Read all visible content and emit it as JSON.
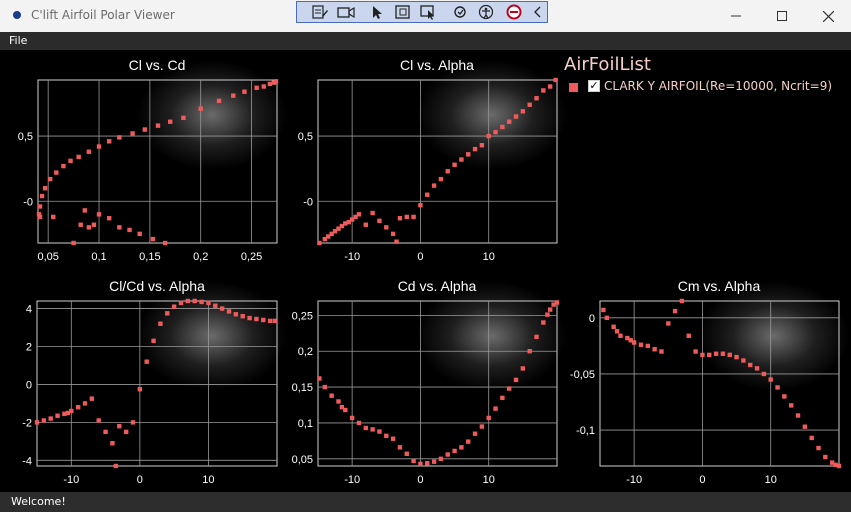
{
  "window": {
    "title": "C'lift Airfoil Polar Viewer"
  },
  "menu": {
    "file": "File"
  },
  "status": {
    "text": "Welcome!"
  },
  "legend": {
    "title": "AirFoilList",
    "item": "CLARK Y AIRFOIL(Re=10000, Ncrit=9)",
    "checked": true
  },
  "colors": {
    "series": "#ef5b5b",
    "grid": "#9a9a9a",
    "background": "#000000"
  },
  "toolbar": {
    "icons": [
      "edit-grid-icon",
      "camera-icon",
      "select-arrow-icon",
      "zoom-box-icon",
      "zoom-select-icon",
      "settings-icon",
      "person-icon",
      "stop-icon",
      "collapse-chevron-icon"
    ]
  },
  "chart_data": [
    {
      "type": "scatter",
      "title": "Cl vs. Cd",
      "x_ticks": [
        0.05,
        0.1,
        0.15,
        0.2,
        0.25
      ],
      "x_tick_labels": [
        "0,05",
        "0,1",
        "0,15",
        "0,2",
        "0,25"
      ],
      "y_ticks": [
        -0.5,
        0,
        0.5
      ],
      "y_tick_labels": [
        "",
        "-0",
        "0,5"
      ],
      "xlim": [
        0.04,
        0.275
      ],
      "ylim": [
        -0.32,
        0.93
      ],
      "points": [
        [
          0.041,
          -0.1
        ],
        [
          0.042,
          -0.04
        ],
        [
          0.044,
          0.04
        ],
        [
          0.047,
          0.1
        ],
        [
          0.052,
          0.17
        ],
        [
          0.058,
          0.22
        ],
        [
          0.065,
          0.27
        ],
        [
          0.072,
          0.31
        ],
        [
          0.08,
          0.34
        ],
        [
          0.09,
          0.38
        ],
        [
          0.1,
          0.42
        ],
        [
          0.11,
          0.46
        ],
        [
          0.12,
          0.49
        ],
        [
          0.133,
          0.52
        ],
        [
          0.145,
          0.55
        ],
        [
          0.158,
          0.58
        ],
        [
          0.17,
          0.61
        ],
        [
          0.183,
          0.64
        ],
        [
          0.2,
          0.71
        ],
        [
          0.218,
          0.77
        ],
        [
          0.232,
          0.81
        ],
        [
          0.243,
          0.84
        ],
        [
          0.255,
          0.87
        ],
        [
          0.262,
          0.88
        ],
        [
          0.268,
          0.9
        ],
        [
          0.272,
          0.91
        ],
        [
          0.274,
          0.92
        ],
        [
          0.042,
          -0.12
        ],
        [
          0.055,
          -0.12
        ],
        [
          0.075,
          -0.32
        ],
        [
          0.082,
          -0.18
        ],
        [
          0.086,
          -0.07
        ],
        [
          0.09,
          -0.2
        ],
        [
          0.095,
          -0.18
        ],
        [
          0.1,
          -0.1
        ],
        [
          0.11,
          -0.13
        ],
        [
          0.12,
          -0.2
        ],
        [
          0.13,
          -0.22
        ],
        [
          0.14,
          -0.25
        ],
        [
          0.153,
          -0.29
        ],
        [
          0.165,
          -0.32
        ]
      ]
    },
    {
      "type": "scatter",
      "title": "Cl vs. Alpha",
      "x_ticks": [
        -10,
        0,
        10
      ],
      "x_tick_labels": [
        "-10",
        "0",
        "10"
      ],
      "y_ticks": [
        -0.5,
        0,
        0.5
      ],
      "y_tick_labels": [
        "",
        "-0",
        "0,5"
      ],
      "xlim": [
        -15,
        20
      ],
      "ylim": [
        -0.32,
        0.93
      ],
      "points": [
        [
          -14.8,
          -0.32
        ],
        [
          -14,
          -0.29
        ],
        [
          -13.5,
          -0.27
        ],
        [
          -13,
          -0.25
        ],
        [
          -12.5,
          -0.23
        ],
        [
          -12,
          -0.21
        ],
        [
          -11.5,
          -0.19
        ],
        [
          -11,
          -0.17
        ],
        [
          -10.5,
          -0.16
        ],
        [
          -10,
          -0.14
        ],
        [
          -9.5,
          -0.12
        ],
        [
          -9,
          -0.1
        ],
        [
          -8,
          -0.18
        ],
        [
          -7,
          -0.09
        ],
        [
          -6,
          -0.15
        ],
        [
          -5,
          -0.2
        ],
        [
          -4,
          -0.25
        ],
        [
          -3.5,
          -0.31
        ],
        [
          -3,
          -0.13
        ],
        [
          -2,
          -0.12
        ],
        [
          -1,
          -0.12
        ],
        [
          0,
          -0.03
        ],
        [
          1,
          0.05
        ],
        [
          2,
          0.12
        ],
        [
          3,
          0.17
        ],
        [
          4,
          0.23
        ],
        [
          5,
          0.28
        ],
        [
          6,
          0.32
        ],
        [
          7,
          0.36
        ],
        [
          8,
          0.4
        ],
        [
          9,
          0.43
        ],
        [
          10,
          0.5
        ],
        [
          11,
          0.53
        ],
        [
          12,
          0.57
        ],
        [
          13,
          0.61
        ],
        [
          14,
          0.65
        ],
        [
          15,
          0.69
        ],
        [
          16,
          0.74
        ],
        [
          17,
          0.79
        ],
        [
          18,
          0.85
        ],
        [
          19,
          0.88
        ],
        [
          19.8,
          0.93
        ]
      ]
    },
    {
      "type": "scatter",
      "title": "Cl/Cd vs. Alpha",
      "x_ticks": [
        -10,
        0,
        10
      ],
      "x_tick_labels": [
        "-10",
        "0",
        "10"
      ],
      "y_ticks": [
        -4,
        -2,
        0,
        2,
        4
      ],
      "y_tick_labels": [
        "-4",
        "-2",
        "0",
        "2",
        "4"
      ],
      "xlim": [
        -15,
        20
      ],
      "ylim": [
        -4.3,
        4.4
      ],
      "points": [
        [
          -15,
          -2
        ],
        [
          -14,
          -1.9
        ],
        [
          -13,
          -1.8
        ],
        [
          -12,
          -1.65
        ],
        [
          -11,
          -1.55
        ],
        [
          -10.5,
          -1.5
        ],
        [
          -10,
          -1.4
        ],
        [
          -9,
          -1.2
        ],
        [
          -8,
          -1
        ],
        [
          -7,
          -0.75
        ],
        [
          -6,
          -1.9
        ],
        [
          -5,
          -2.5
        ],
        [
          -4,
          -3.1
        ],
        [
          -3.5,
          -4.3
        ],
        [
          -3,
          -2.2
        ],
        [
          -2,
          -2.5
        ],
        [
          -1,
          -2
        ],
        [
          0,
          -0.25
        ],
        [
          1,
          1.2
        ],
        [
          2,
          2.3
        ],
        [
          3,
          3.2
        ],
        [
          4,
          3.75
        ],
        [
          5,
          4.1
        ],
        [
          6,
          4.3
        ],
        [
          7,
          4.4
        ],
        [
          8,
          4.4
        ],
        [
          9,
          4.35
        ],
        [
          10,
          4.3
        ],
        [
          11,
          4.15
        ],
        [
          12,
          4
        ],
        [
          13,
          3.85
        ],
        [
          14,
          3.7
        ],
        [
          15,
          3.6
        ],
        [
          16,
          3.5
        ],
        [
          17,
          3.45
        ],
        [
          18,
          3.4
        ],
        [
          19,
          3.35
        ],
        [
          19.7,
          3.35
        ]
      ]
    },
    {
      "type": "scatter",
      "title": "Cd vs. Alpha",
      "x_ticks": [
        -10,
        0,
        10
      ],
      "x_tick_labels": [
        "-10",
        "0",
        "10"
      ],
      "y_ticks": [
        0.05,
        0.1,
        0.15,
        0.2,
        0.25
      ],
      "y_tick_labels": [
        "0,05",
        "0,1",
        "0,15",
        "0,2",
        "0,25"
      ],
      "xlim": [
        -15,
        20
      ],
      "ylim": [
        0.04,
        0.27
      ],
      "points": [
        [
          -14.8,
          0.162
        ],
        [
          -14,
          0.15
        ],
        [
          -13,
          0.138
        ],
        [
          -12,
          0.13
        ],
        [
          -11.5,
          0.122
        ],
        [
          -11,
          0.118
        ],
        [
          -10,
          0.107
        ],
        [
          -9,
          0.1
        ],
        [
          -8,
          0.093
        ],
        [
          -7,
          0.091
        ],
        [
          -6,
          0.088
        ],
        [
          -5,
          0.082
        ],
        [
          -4,
          0.078
        ],
        [
          -3,
          0.066
        ],
        [
          -2,
          0.057
        ],
        [
          -1,
          0.047
        ],
        [
          0,
          0.043
        ],
        [
          1,
          0.044
        ],
        [
          2,
          0.046
        ],
        [
          3,
          0.05
        ],
        [
          4,
          0.056
        ],
        [
          5,
          0.061
        ],
        [
          6,
          0.066
        ],
        [
          7,
          0.074
        ],
        [
          8,
          0.085
        ],
        [
          9,
          0.095
        ],
        [
          10,
          0.107
        ],
        [
          11,
          0.12
        ],
        [
          12,
          0.135
        ],
        [
          13,
          0.148
        ],
        [
          14,
          0.16
        ],
        [
          15,
          0.176
        ],
        [
          16,
          0.2
        ],
        [
          17,
          0.22
        ],
        [
          18,
          0.24
        ],
        [
          18.6,
          0.251
        ],
        [
          19,
          0.258
        ],
        [
          19.5,
          0.265
        ],
        [
          20,
          0.268
        ]
      ]
    },
    {
      "type": "scatter",
      "title": "Cm vs. Alpha",
      "x_ticks": [
        -10,
        0,
        10
      ],
      "x_tick_labels": [
        "-10",
        "0",
        "10"
      ],
      "y_ticks": [
        -0.1,
        -0.05,
        0
      ],
      "y_tick_labels": [
        "-0,1",
        "-0,05",
        "0"
      ],
      "xlim": [
        -15,
        20
      ],
      "ylim": [
        -0.132,
        0.015
      ],
      "points": [
        [
          -14.5,
          0.007
        ],
        [
          -14,
          0
        ],
        [
          -13,
          -0.008
        ],
        [
          -12.5,
          -0.012
        ],
        [
          -12,
          -0.016
        ],
        [
          -11,
          -0.018
        ],
        [
          -10.5,
          -0.02
        ],
        [
          -10,
          -0.022
        ],
        [
          -9,
          -0.024
        ],
        [
          -8,
          -0.025
        ],
        [
          -7,
          -0.028
        ],
        [
          -6,
          -0.03
        ],
        [
          -5,
          -0.005
        ],
        [
          -4,
          0.006
        ],
        [
          -3,
          0.015
        ],
        [
          -2,
          -0.016
        ],
        [
          -1,
          -0.03
        ],
        [
          0,
          -0.033
        ],
        [
          1,
          -0.033
        ],
        [
          2,
          -0.032
        ],
        [
          3,
          -0.032
        ],
        [
          4,
          -0.033
        ],
        [
          5,
          -0.035
        ],
        [
          6,
          -0.038
        ],
        [
          7,
          -0.042
        ],
        [
          8,
          -0.045
        ],
        [
          9,
          -0.05
        ],
        [
          10,
          -0.055
        ],
        [
          11,
          -0.062
        ],
        [
          12,
          -0.07
        ],
        [
          13,
          -0.078
        ],
        [
          14,
          -0.087
        ],
        [
          15,
          -0.097
        ],
        [
          16,
          -0.107
        ],
        [
          17,
          -0.116
        ],
        [
          18,
          -0.124
        ],
        [
          19,
          -0.129
        ],
        [
          19.5,
          -0.131
        ],
        [
          20,
          -0.132
        ]
      ]
    }
  ]
}
